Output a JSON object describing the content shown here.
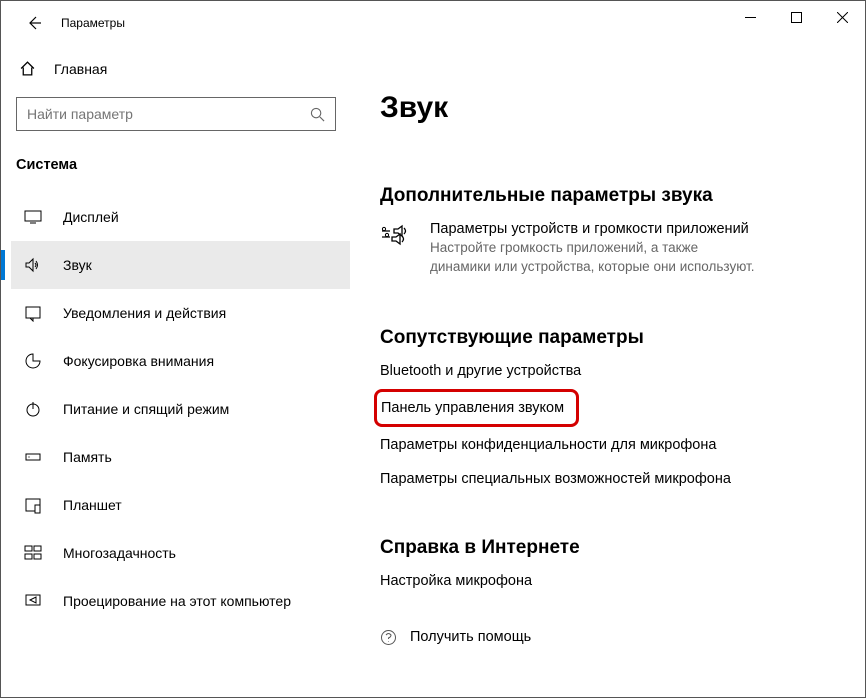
{
  "titlebar": {
    "title": "Параметры"
  },
  "sidebar": {
    "home": "Главная",
    "search_placeholder": "Найти параметр",
    "category": "Система",
    "items": [
      {
        "label": "Дисплей"
      },
      {
        "label": "Звук"
      },
      {
        "label": "Уведомления и действия"
      },
      {
        "label": "Фокусировка внимания"
      },
      {
        "label": "Питание и спящий режим"
      },
      {
        "label": "Память"
      },
      {
        "label": "Планшет"
      },
      {
        "label": "Многозадачность"
      },
      {
        "label": "Проецирование на этот компьютер"
      }
    ]
  },
  "main": {
    "page_title": "Звук",
    "advanced": {
      "title": "Дополнительные параметры звука",
      "device_title": "Параметры устройств и громкости приложений",
      "device_desc": "Настройте громкость приложений, а также динамики или устройства, которые они используют."
    },
    "related": {
      "title": "Сопутствующие параметры",
      "links": [
        "Bluetooth и другие устройства",
        "Панель управления звуком",
        "Параметры конфиденциальности для микрофона",
        "Параметры специальных возможностей микрофона"
      ]
    },
    "help": {
      "title": "Справка в Интернете",
      "links": [
        "Настройка микрофона"
      ],
      "get_help": "Получить помощь"
    }
  }
}
